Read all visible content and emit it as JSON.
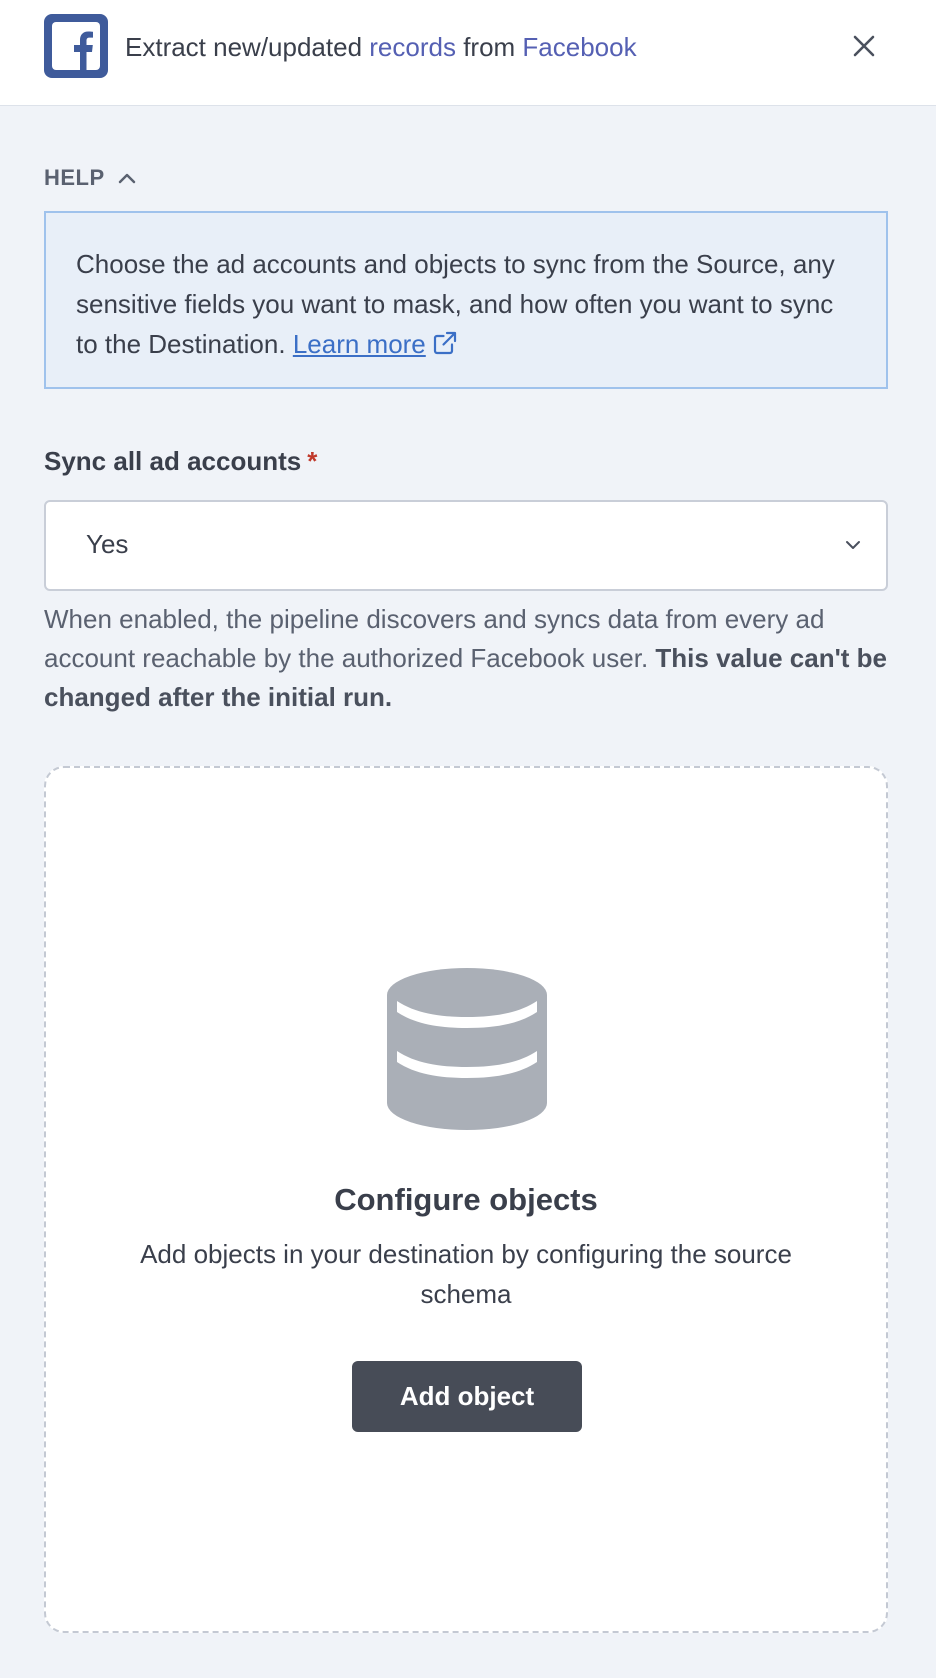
{
  "header": {
    "title_prefix": "Extract new/updated ",
    "title_entity": "records",
    "title_middle": " from ",
    "title_source": "Facebook",
    "logo_icon": "facebook-logo-icon",
    "close_icon": "close-icon"
  },
  "help": {
    "toggle_label": "HELP",
    "text": "Choose the ad accounts and objects to sync from the Source, any sensitive fields you want to mask, and how often you want to sync to the Destination. ",
    "link_label": "Learn more",
    "link_icon": "external-link-icon"
  },
  "sync_field": {
    "label": "Sync all ad accounts",
    "required_marker": "*",
    "value": "Yes",
    "description": "When enabled, the pipeline discovers and syncs data from every ad account reachable by the authorized Facebook user. ",
    "description_bold": "This value can't be changed after the initial run."
  },
  "objects": {
    "icon": "database-icon",
    "title": "Configure objects",
    "description": "Add objects in your destination by configuring the source schema",
    "button_label": "Add object"
  },
  "colors": {
    "accent": "#5560b3",
    "facebook": "#3f5b9b",
    "link": "#3b6fc6",
    "required": "#c0392b",
    "button": "#474c57"
  }
}
